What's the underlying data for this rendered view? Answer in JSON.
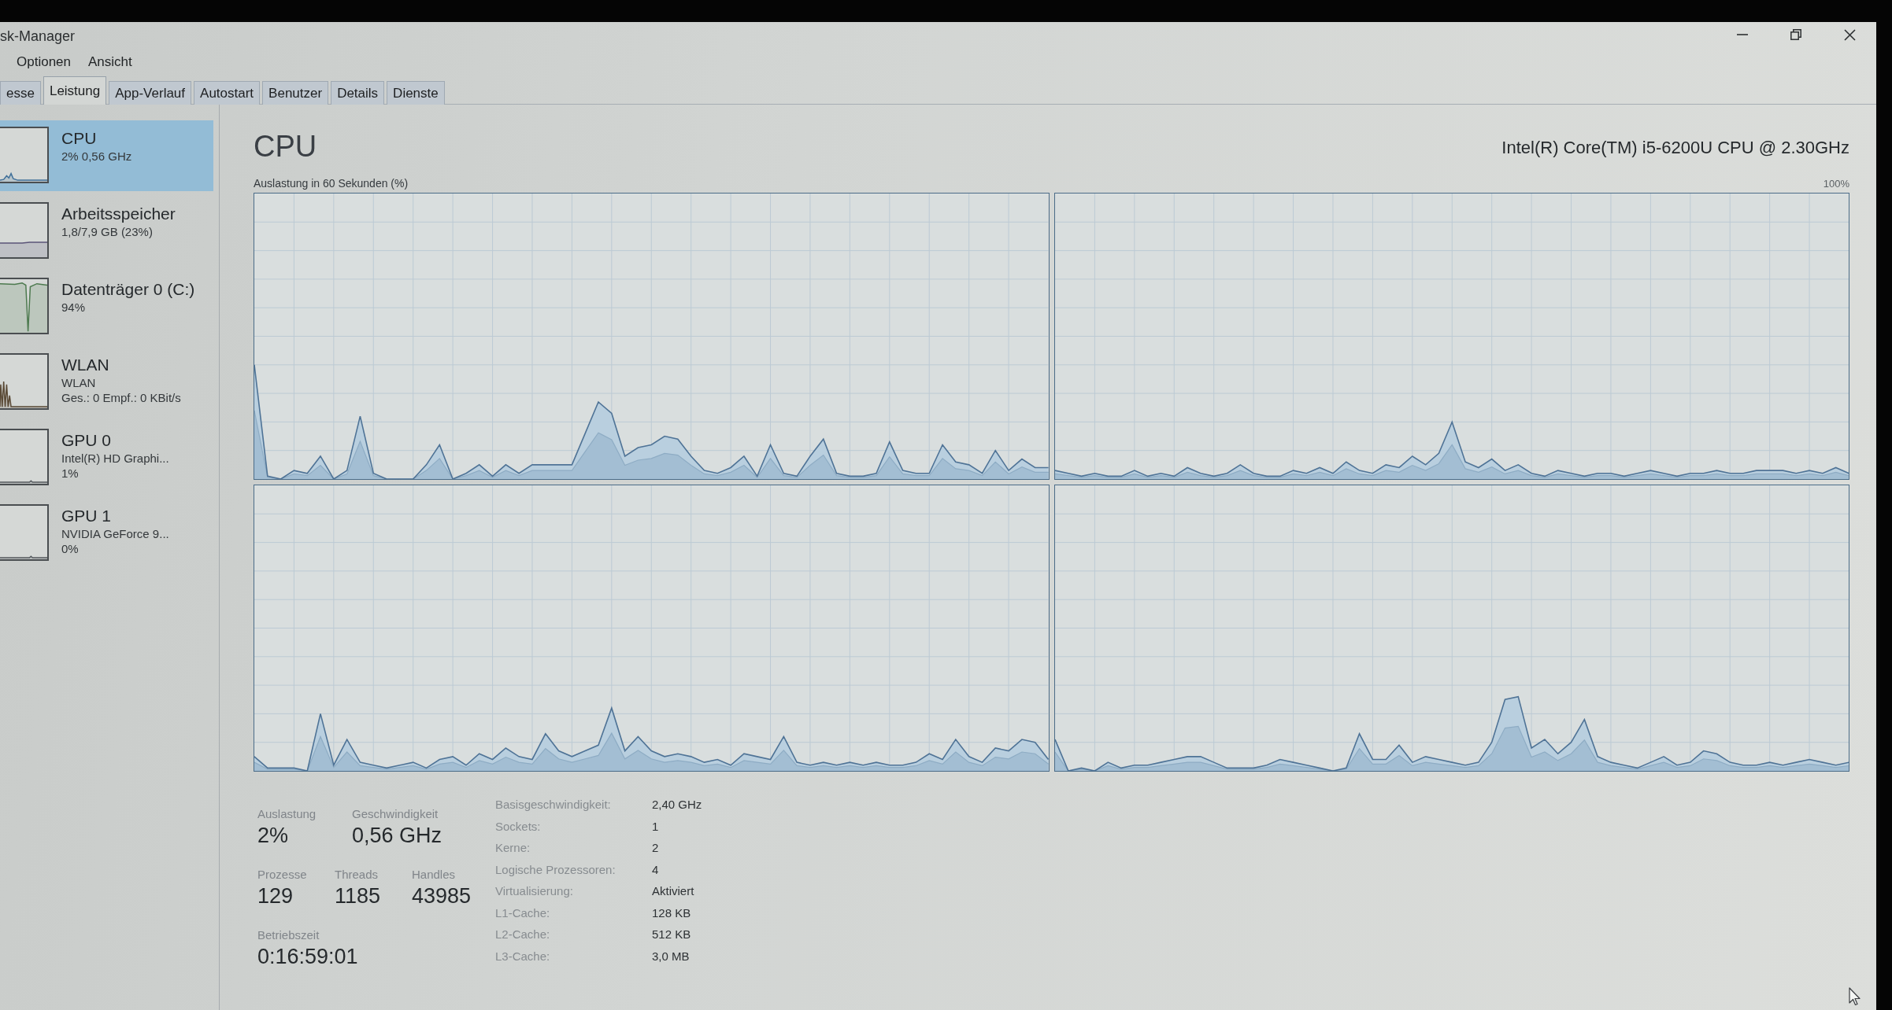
{
  "window": {
    "title": "sk-Manager"
  },
  "menu": [
    {
      "label": "Optionen"
    },
    {
      "label": "Ansicht"
    }
  ],
  "tabs": [
    {
      "label": "esse",
      "selected": false
    },
    {
      "label": "Leistung",
      "selected": true
    },
    {
      "label": "App-Verlauf",
      "selected": false
    },
    {
      "label": "Autostart",
      "selected": false
    },
    {
      "label": "Benutzer",
      "selected": false
    },
    {
      "label": "Details",
      "selected": false
    },
    {
      "label": "Dienste",
      "selected": false
    }
  ],
  "sidebar": {
    "items": [
      {
        "kind": "cpu",
        "title": "CPU",
        "lines": [
          "2% 0,56 GHz"
        ],
        "selected": true
      },
      {
        "kind": "memory",
        "title": "Arbeitsspeicher",
        "lines": [
          "1,8/7,9 GB (23%)"
        ],
        "selected": false
      },
      {
        "kind": "disk",
        "title": "Datenträger 0 (C:)",
        "lines": [
          "94%"
        ],
        "selected": false
      },
      {
        "kind": "network",
        "title": "WLAN",
        "lines": [
          "WLAN",
          "Ges.: 0 Empf.: 0 KBit/s"
        ],
        "selected": false
      },
      {
        "kind": "gpu",
        "title": "GPU 0",
        "lines": [
          "Intel(R) HD Graphi...",
          "1%"
        ],
        "selected": false
      },
      {
        "kind": "gpu",
        "title": "GPU 1",
        "lines": [
          "NVIDIA GeForce 9...",
          "0%"
        ],
        "selected": false
      }
    ]
  },
  "panel": {
    "title": "CPU",
    "model": "Intel(R) Core(TM) i5-6200U CPU @ 2.30GHz",
    "graph_caption": "Auslastung in 60 Sekunden (%)",
    "graph_max": "100%",
    "stat_rows": [
      [
        {
          "label": "Auslastung",
          "value": "2%"
        },
        {
          "label": "Geschwindigkeit",
          "value": "0,56 GHz"
        }
      ],
      [
        {
          "label": "Prozesse",
          "value": "129"
        },
        {
          "label": "Threads",
          "value": "1185"
        },
        {
          "label": "Handles",
          "value": "43985"
        }
      ],
      [
        {
          "label": "Betriebszeit",
          "value": "0:16:59:01"
        }
      ]
    ],
    "details": [
      {
        "label": "Basisgeschwindigkeit:",
        "value": "2,40 GHz"
      },
      {
        "label": "Sockets:",
        "value": "1"
      },
      {
        "label": "Kerne:",
        "value": "2"
      },
      {
        "label": "Logische Prozessoren:",
        "value": "4"
      },
      {
        "label": "Virtualisierung:",
        "value": "Aktiviert"
      },
      {
        "label": "L1-Cache:",
        "value": "128 KB"
      },
      {
        "label": "L2-Cache:",
        "value": "512 KB"
      },
      {
        "label": "L3-Cache:",
        "value": "3,0 MB"
      }
    ]
  }
}
